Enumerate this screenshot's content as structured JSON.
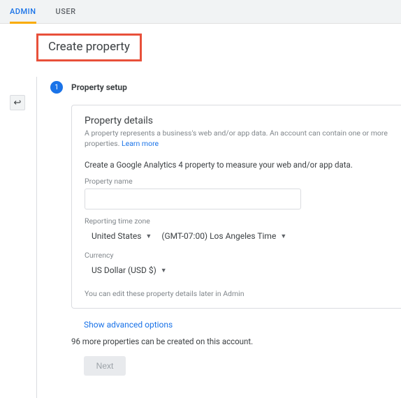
{
  "tabs": {
    "admin": "ADMIN",
    "user": "USER"
  },
  "heading": "Create property",
  "step": {
    "number": "1",
    "title": "Property setup"
  },
  "card": {
    "title": "Property details",
    "desc": "A property represents a business's web and/or app data. An account can contain one or more properties.",
    "learn": "Learn more",
    "sub": "Create a Google Analytics 4 property to measure your web and/or app data.",
    "propname_label": "Property name",
    "propname_value": "",
    "tz_label": "Reporting time zone",
    "tz_country": "United States",
    "tz_zone": "(GMT-07:00) Los Angeles Time",
    "currency_label": "Currency",
    "currency_value": "US Dollar (USD $)",
    "note": "You can edit these property details later in Admin"
  },
  "advanced": "Show advanced options",
  "quota": "96 more properties can be created on this account.",
  "next": "Next"
}
